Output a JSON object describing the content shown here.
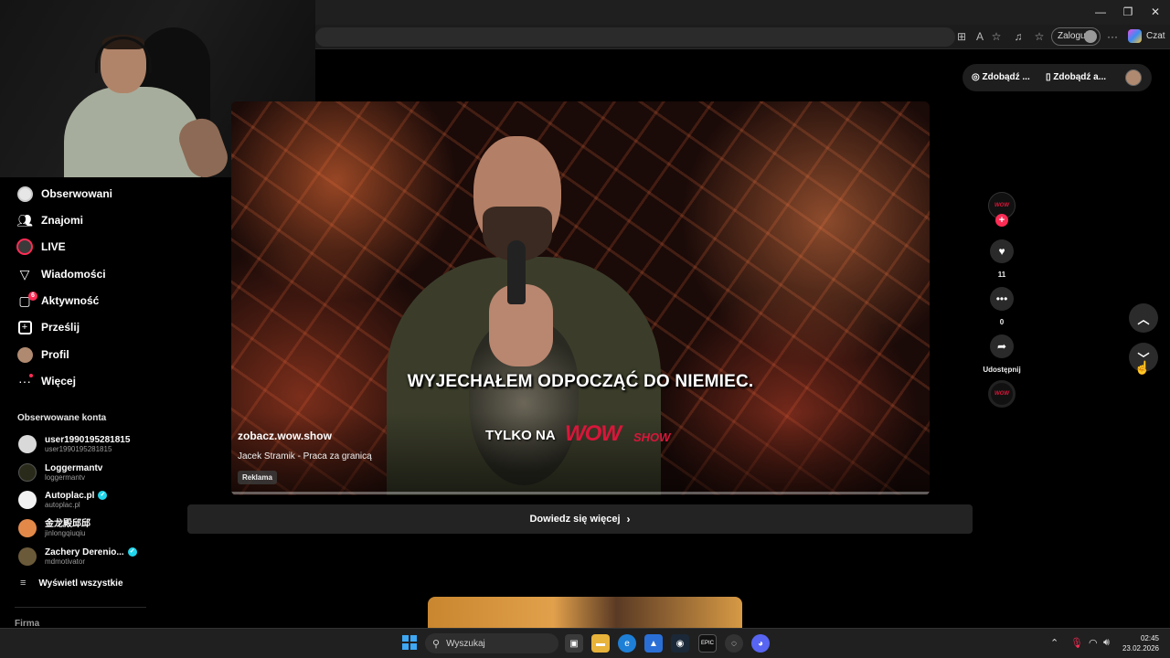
{
  "window": {
    "minimize": "—",
    "maximize": "❐",
    "close": "✕"
  },
  "toolbar": {
    "login_label": "Zaloguj",
    "chat_label": "Czat"
  },
  "top_pills": {
    "coins_label": "Zdobądź ...",
    "app_label": "Zdobądź a..."
  },
  "sidebar": {
    "items": [
      {
        "label": "Obserwowani",
        "icon": "following-icon"
      },
      {
        "label": "Znajomi",
        "icon": "friends-icon"
      },
      {
        "label": "LIVE",
        "icon": "live-icon"
      },
      {
        "label": "Wiadomości",
        "icon": "messages-icon"
      },
      {
        "label": "Aktywność",
        "icon": "activity-icon",
        "badge": "6"
      },
      {
        "label": "Prześlij",
        "icon": "upload-icon"
      },
      {
        "label": "Profil",
        "icon": "profile-icon"
      },
      {
        "label": "Więcej",
        "icon": "more-icon"
      }
    ],
    "followed_title": "Obserwowane konta",
    "accounts": [
      {
        "name": "user1990195281815",
        "user": "user1990195281815",
        "verified": false,
        "color": "#d9d9d9"
      },
      {
        "name": "Loggermantv",
        "user": "loggermantv",
        "verified": false,
        "color": "#2a2a1a"
      },
      {
        "name": "Autoplac.pl",
        "user": "autoplac.pl",
        "verified": true,
        "color": "#f2f2f2"
      },
      {
        "name": "金龙殿邱邱",
        "user": "jinlongqiuqiu",
        "verified": false,
        "color": "#e2894a"
      },
      {
        "name": "Zachery Derenio...",
        "user": "mdmotivator",
        "verified": true,
        "color": "#6b5a3a"
      }
    ],
    "show_all": "Wyświetl wszystkie",
    "footer_label": "Firma"
  },
  "video": {
    "subtitle": "WYJECHAŁEM ODPOCZĄĆ DO NIEMIEC.",
    "promo_prefix": "TYLKO NA",
    "promo_brand": "WOW",
    "promo_suffix": "SHOW",
    "handle": "zobacz.wow.show",
    "description": "Jacek Stramik - Praca za granicą",
    "ad_label": "Reklama"
  },
  "learn_more": "Dowiedz się więcej",
  "actions": {
    "likes": "11",
    "comments": "0",
    "share_label": "Udostępnij",
    "avatar_text": "WOW"
  },
  "taskbar": {
    "search_placeholder": "Wyszukaj",
    "time": "02:45",
    "date": "23.02.2026"
  },
  "colors": {
    "accent": "#fe2c55",
    "brand_wow": "#d9163a",
    "verified": "#20d5ec"
  }
}
